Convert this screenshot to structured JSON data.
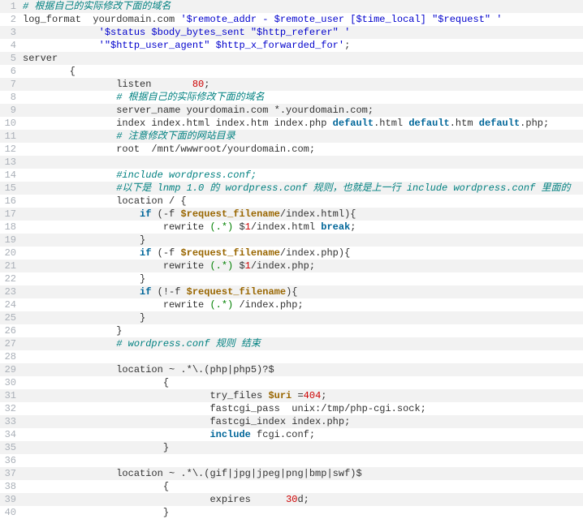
{
  "lines": [
    {
      "n": 1,
      "tokens": [
        [
          "comment",
          "# 根据自己的实际修改下面的域名"
        ]
      ]
    },
    {
      "n": 2,
      "tokens": [
        [
          "plain",
          "log_format  yourdomain.com "
        ],
        [
          "str",
          "'$remote_addr - $remote_user [$time_local] \"$request\" '"
        ]
      ]
    },
    {
      "n": 3,
      "tokens": [
        [
          "plain",
          "             "
        ],
        [
          "str",
          "'$status $body_bytes_sent \"$http_referer\" '"
        ]
      ]
    },
    {
      "n": 4,
      "tokens": [
        [
          "plain",
          "             "
        ],
        [
          "str",
          "'\"$http_user_agent\" $http_x_forwarded_for'"
        ],
        [
          "plain",
          ";"
        ]
      ]
    },
    {
      "n": 5,
      "tokens": [
        [
          "plain",
          "server"
        ]
      ]
    },
    {
      "n": 6,
      "tokens": [
        [
          "plain",
          "        {"
        ]
      ]
    },
    {
      "n": 7,
      "tokens": [
        [
          "plain",
          "                listen       "
        ],
        [
          "num",
          "80"
        ],
        [
          "plain",
          ";"
        ]
      ]
    },
    {
      "n": 8,
      "tokens": [
        [
          "plain",
          "                "
        ],
        [
          "comment",
          "# 根据自己的实际修改下面的域名"
        ]
      ]
    },
    {
      "n": 9,
      "tokens": [
        [
          "plain",
          "                server_name yourdomain.com *.yourdomain.com;"
        ]
      ]
    },
    {
      "n": 10,
      "tokens": [
        [
          "plain",
          "                index index.html index.htm index.php "
        ],
        [
          "kw",
          "default"
        ],
        [
          "plain",
          ".html "
        ],
        [
          "kw",
          "default"
        ],
        [
          "plain",
          ".htm "
        ],
        [
          "kw",
          "default"
        ],
        [
          "plain",
          ".php;"
        ]
      ]
    },
    {
      "n": 11,
      "tokens": [
        [
          "plain",
          "                "
        ],
        [
          "comment",
          "# 注意修改下面的网站目录"
        ]
      ]
    },
    {
      "n": 12,
      "tokens": [
        [
          "plain",
          "                root  /mnt/wwwroot/yourdomain.com;"
        ]
      ]
    },
    {
      "n": 13,
      "tokens": [
        [
          "plain",
          ""
        ]
      ]
    },
    {
      "n": 14,
      "tokens": [
        [
          "plain",
          "                "
        ],
        [
          "comment",
          "#include wordpress.conf;"
        ]
      ]
    },
    {
      "n": 15,
      "tokens": [
        [
          "plain",
          "                "
        ],
        [
          "comment",
          "#以下是 lnmp 1.0 的 wordpress.conf 规则，也就是上一行 include wordpress.conf 里面的"
        ]
      ]
    },
    {
      "n": 16,
      "tokens": [
        [
          "plain",
          "                location / {"
        ]
      ]
    },
    {
      "n": 17,
      "tokens": [
        [
          "plain",
          "                    "
        ],
        [
          "kw",
          "if"
        ],
        [
          "plain",
          " (-f "
        ],
        [
          "var",
          "$request_filename"
        ],
        [
          "plain",
          "/index.html){"
        ]
      ]
    },
    {
      "n": 18,
      "tokens": [
        [
          "plain",
          "                        rewrite "
        ],
        [
          "regex",
          "(.*)"
        ],
        [
          "plain",
          " $"
        ],
        [
          "num",
          "1"
        ],
        [
          "plain",
          "/index.html "
        ],
        [
          "kw",
          "break"
        ],
        [
          "plain",
          ";"
        ]
      ]
    },
    {
      "n": 19,
      "tokens": [
        [
          "plain",
          "                    }"
        ]
      ]
    },
    {
      "n": 20,
      "tokens": [
        [
          "plain",
          "                    "
        ],
        [
          "kw",
          "if"
        ],
        [
          "plain",
          " (-f "
        ],
        [
          "var",
          "$request_filename"
        ],
        [
          "plain",
          "/index.php){"
        ]
      ]
    },
    {
      "n": 21,
      "tokens": [
        [
          "plain",
          "                        rewrite "
        ],
        [
          "regex",
          "(.*)"
        ],
        [
          "plain",
          " $"
        ],
        [
          "num",
          "1"
        ],
        [
          "plain",
          "/index.php;"
        ]
      ]
    },
    {
      "n": 22,
      "tokens": [
        [
          "plain",
          "                    }"
        ]
      ]
    },
    {
      "n": 23,
      "tokens": [
        [
          "plain",
          "                    "
        ],
        [
          "kw",
          "if"
        ],
        [
          "plain",
          " (!-f "
        ],
        [
          "var",
          "$request_filename"
        ],
        [
          "plain",
          "){"
        ]
      ]
    },
    {
      "n": 24,
      "tokens": [
        [
          "plain",
          "                        rewrite "
        ],
        [
          "regex",
          "(.*)"
        ],
        [
          "plain",
          " /index.php;"
        ]
      ]
    },
    {
      "n": 25,
      "tokens": [
        [
          "plain",
          "                    }"
        ]
      ]
    },
    {
      "n": 26,
      "tokens": [
        [
          "plain",
          "                }"
        ]
      ]
    },
    {
      "n": 27,
      "tokens": [
        [
          "plain",
          "                "
        ],
        [
          "comment",
          "# wordpress.conf 规则 结束"
        ]
      ]
    },
    {
      "n": 28,
      "tokens": [
        [
          "plain",
          ""
        ]
      ]
    },
    {
      "n": 29,
      "tokens": [
        [
          "plain",
          "                location ~ .*\\.(php|php5)?$"
        ]
      ]
    },
    {
      "n": 30,
      "tokens": [
        [
          "plain",
          "                        {"
        ]
      ]
    },
    {
      "n": 31,
      "tokens": [
        [
          "plain",
          "                                try_files "
        ],
        [
          "var",
          "$uri"
        ],
        [
          "plain",
          " ="
        ],
        [
          "num",
          "404"
        ],
        [
          "plain",
          ";"
        ]
      ]
    },
    {
      "n": 32,
      "tokens": [
        [
          "plain",
          "                                fastcgi_pass  unix:/tmp/php-cgi.sock;"
        ]
      ]
    },
    {
      "n": 33,
      "tokens": [
        [
          "plain",
          "                                fastcgi_index index.php;"
        ]
      ]
    },
    {
      "n": 34,
      "tokens": [
        [
          "plain",
          "                                "
        ],
        [
          "kw",
          "include"
        ],
        [
          "plain",
          " fcgi.conf;"
        ]
      ]
    },
    {
      "n": 35,
      "tokens": [
        [
          "plain",
          "                        }"
        ]
      ]
    },
    {
      "n": 36,
      "tokens": [
        [
          "plain",
          ""
        ]
      ]
    },
    {
      "n": 37,
      "tokens": [
        [
          "plain",
          "                location ~ .*\\.(gif|jpg|jpeg|png|bmp|swf)$"
        ]
      ]
    },
    {
      "n": 38,
      "tokens": [
        [
          "plain",
          "                        {"
        ]
      ]
    },
    {
      "n": 39,
      "tokens": [
        [
          "plain",
          "                                expires      "
        ],
        [
          "num",
          "30"
        ],
        [
          "plain",
          "d;"
        ]
      ]
    },
    {
      "n": 40,
      "tokens": [
        [
          "plain",
          "                        }"
        ]
      ]
    }
  ]
}
